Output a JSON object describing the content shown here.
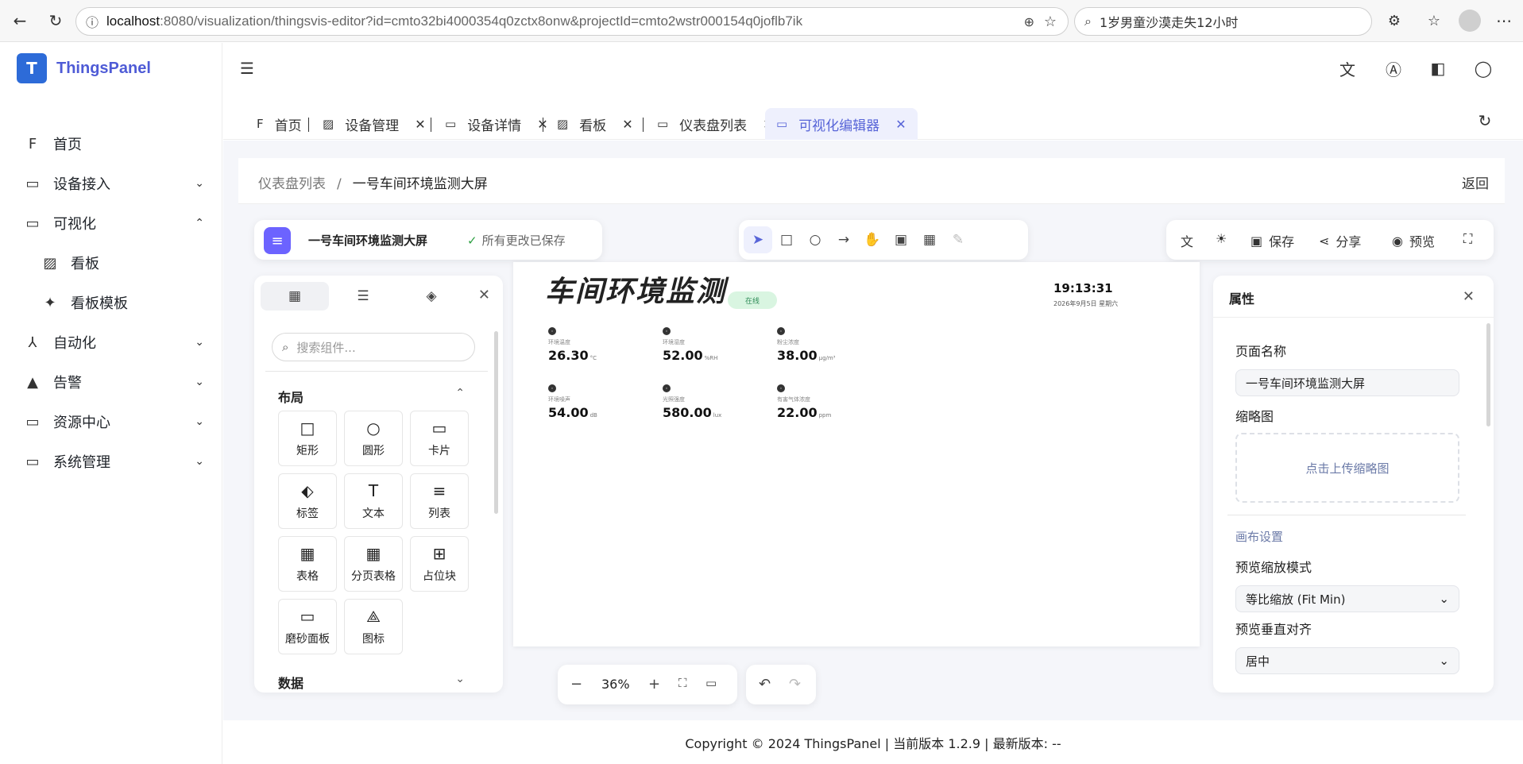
{
  "browser": {
    "url_host": "localhost",
    "url_rest": ":8080/visualization/thingsvis-editor?id=cmto32bi4000354q0zctx8onw&projectId=cmto2wstr000154q0joflb7ik",
    "search_text": "1岁男童沙漠走失12小时"
  },
  "sidebar": {
    "brand": "ThingsPanel",
    "logo_letter": "T",
    "items": [
      {
        "label": "首页",
        "icon": "home-icon",
        "glyph": "F"
      },
      {
        "label": "设备接入",
        "icon": "monitor-icon",
        "glyph": "▭",
        "chevron": "⌄"
      },
      {
        "label": "可视化",
        "icon": "laptop-icon",
        "glyph": "▭",
        "chevron": "⌃"
      },
      {
        "label": "看板",
        "icon": "chart-icon",
        "glyph": "▨",
        "sub": true
      },
      {
        "label": "看板模板",
        "icon": "puzzle-icon",
        "glyph": "✦",
        "sub": true
      },
      {
        "label": "自动化",
        "icon": "flow-icon",
        "glyph": "⅄",
        "chevron": "⌄"
      },
      {
        "label": "告警",
        "icon": "warning-icon",
        "glyph": "▲",
        "chevron": "⌄"
      },
      {
        "label": "资源中心",
        "icon": "laptop-icon",
        "glyph": "▭",
        "chevron": "⌄"
      },
      {
        "label": "系统管理",
        "icon": "settings-monitor-icon",
        "glyph": "▭",
        "chevron": "⌄"
      }
    ]
  },
  "tabs": [
    {
      "label": "首页",
      "closable": false
    },
    {
      "label": "设备管理",
      "closable": true
    },
    {
      "label": "设备详情",
      "closable": true
    },
    {
      "label": "看板",
      "closable": true
    },
    {
      "label": "仪表盘列表",
      "closable": true
    },
    {
      "label": "可视化编辑器",
      "closable": true,
      "active": true
    }
  ],
  "breadcrumb": {
    "parent": "仪表盘列表",
    "separator": "/",
    "current": "一号车间环境监测大屏",
    "back": "返回"
  },
  "editor": {
    "project_title": "一号车间环境监测大屏",
    "save_status": "所有更改已保存",
    "actions": {
      "save": "保存",
      "share": "分享",
      "preview": "预览"
    },
    "zoom": "36%"
  },
  "components": {
    "search_placeholder": "搜索组件...",
    "section_layout": "布局",
    "section_data": "数据",
    "items": [
      {
        "label": "矩形",
        "glyph": "□"
      },
      {
        "label": "圆形",
        "glyph": "○"
      },
      {
        "label": "卡片",
        "glyph": "▭"
      },
      {
        "label": "标签",
        "glyph": "⬖"
      },
      {
        "label": "文本",
        "glyph": "T"
      },
      {
        "label": "列表",
        "glyph": "≡"
      },
      {
        "label": "表格",
        "glyph": "▦"
      },
      {
        "label": "分页表格",
        "glyph": "▦"
      },
      {
        "label": "占位块",
        "glyph": "⊞"
      },
      {
        "label": "磨砂面板",
        "glyph": "▭"
      },
      {
        "label": "图标",
        "glyph": "⟁"
      }
    ]
  },
  "canvas": {
    "title": "车间环境监测",
    "badge": "在线",
    "time": "19:13:31",
    "date": "2026年9月5日 星期六",
    "metrics": [
      {
        "label": "环境温度",
        "value": "26.30",
        "unit": "°C"
      },
      {
        "label": "环境湿度",
        "value": "52.00",
        "unit": "%RH"
      },
      {
        "label": "粉尘浓度",
        "value": "38.00",
        "unit": "μg/m³"
      },
      {
        "label": "环境噪声",
        "value": "54.00",
        "unit": "dB"
      },
      {
        "label": "光照强度",
        "value": "580.00",
        "unit": "lux"
      },
      {
        "label": "有害气体浓度",
        "value": "22.00",
        "unit": "ppm"
      }
    ]
  },
  "properties": {
    "title": "属性",
    "page_name_label": "页面名称",
    "page_name_value": "一号车间环境监测大屏",
    "thumb_label": "缩略图",
    "thumb_upload": "点击上传缩略图",
    "section_canvas": "画布设置",
    "scale_label": "预览缩放模式",
    "scale_value": "等比缩放 (Fit Min)",
    "align_label": "预览垂直对齐",
    "align_value": "居中"
  },
  "footer": "Copyright © 2024 ThingsPanel  |  当前版本 1.2.9  |  最新版本: --",
  "colors": {
    "accent": "#5865d8",
    "menu_btn": "#6c63ff",
    "brand_logo": "#2d6bd8",
    "online_badge": "#d9f5e1"
  }
}
